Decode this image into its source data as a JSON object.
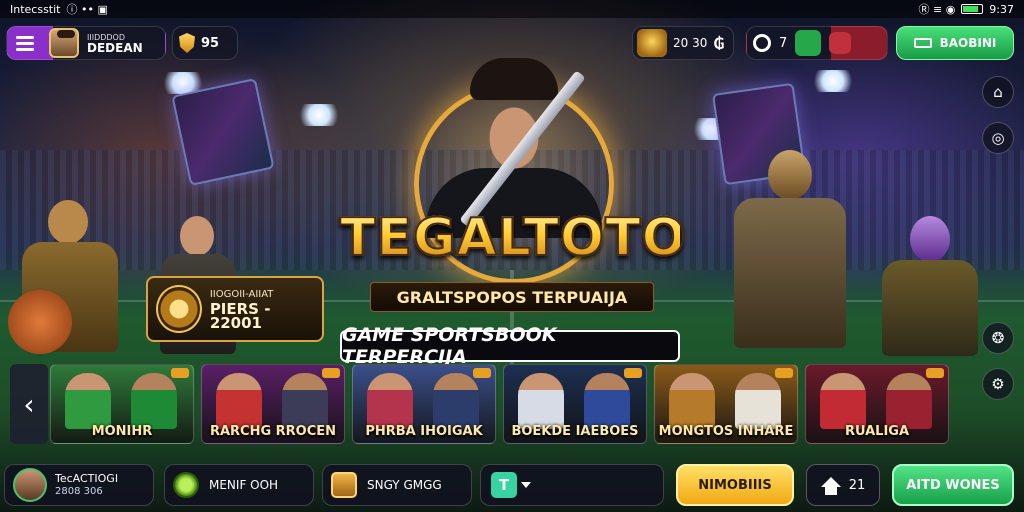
{
  "status_bar": {
    "carrier": "Intecsstit",
    "icons_left": "ⓘ •• ▣",
    "icons_right": "Ⓡ ≡ ◉",
    "time": "9:37"
  },
  "top_bar": {
    "profile_small": "IIIDDDOD",
    "profile_name": "DEDEAN",
    "shield_value": "95",
    "trophy_value": "20 30",
    "trophy_extra": "₲",
    "messages_value": "7",
    "play_label": "BAOBINI"
  },
  "hero": {
    "title": "TEGALTOTO",
    "subtitle": "GRALTSPOPOS TERPUAIJA",
    "banner": "GAME SPORTSBOOK TERPERCIJA"
  },
  "promo": {
    "line1": "IIOGOII-AIIAT",
    "line2": "PIERS - 22001"
  },
  "games": [
    {
      "label": "MONIHR",
      "bg": "#2f7a3a",
      "p1": "#2f9a3f",
      "p2": "#1f8a35"
    },
    {
      "label": "RARCHG  RROCEN",
      "bg": "#5a1f66",
      "p1": "#c43232",
      "p2": "#3c3c58"
    },
    {
      "label": "PHRBA  IHOIGAK",
      "bg": "#3b4f8a",
      "p1": "#b3344c",
      "p2": "#2c3d6b"
    },
    {
      "label": "BOEKDE  IAEBOES",
      "bg": "#1d2f52",
      "p1": "#d6dbe6",
      "p2": "#2f4a9a"
    },
    {
      "label": "MONGTOS  INHARE",
      "bg": "#8a5a1a",
      "p1": "#b57a2a",
      "p2": "#e6e2d8"
    },
    {
      "label": "RUALIGA",
      "bg": "#6a1a2a",
      "p1": "#c22b34",
      "p2": "#9a2230"
    }
  ],
  "bottom_bar": {
    "user_name": "TecACTIOGI",
    "user_sub": "2808 306",
    "mode1_label": "MENIF OOH",
    "mode2_label": "SNGY GMGG",
    "t_icon": "T",
    "yellow_button": "NIMOBIIIS",
    "home_value": "21",
    "green_button": "AITD WONES"
  },
  "icons": {
    "menu": "menu-icon",
    "home_side": "⌂",
    "pin_side": "◎",
    "cube_side": "❂",
    "gear_side": "⚙",
    "prev": "‹"
  }
}
